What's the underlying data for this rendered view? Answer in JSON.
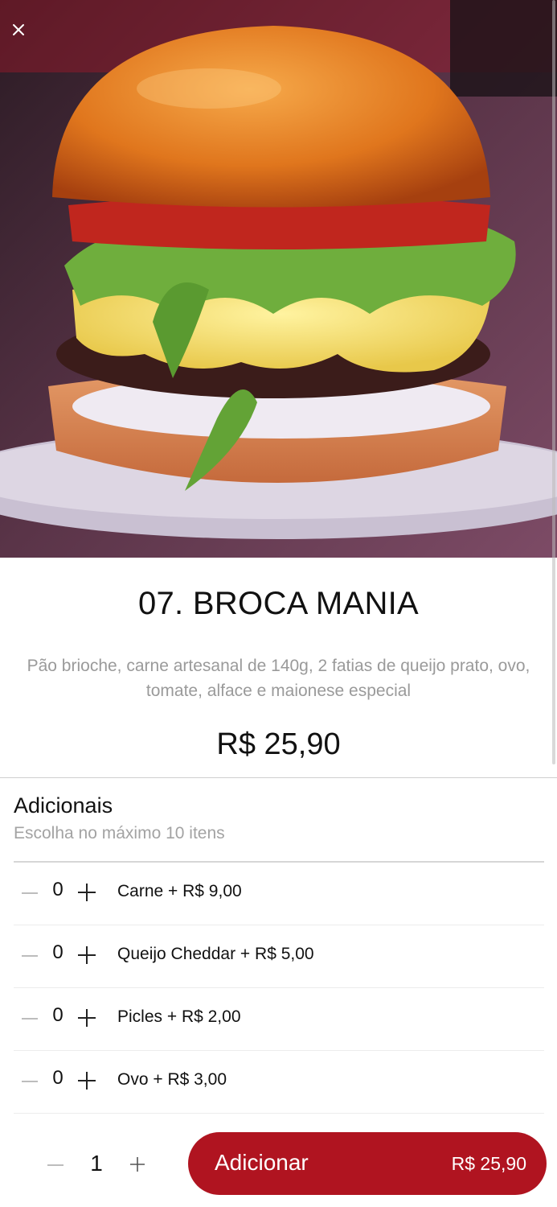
{
  "header": {
    "close_icon": "close-icon",
    "image_alt": "07. BROCA MANIA"
  },
  "product": {
    "title": "07. BROCA MANIA",
    "description": "Pão brioche, carne artesanal de 140g, 2 fatias de queijo prato, ovo, tomate, alface e maionese especial",
    "price": "R$ 25,90"
  },
  "addons": {
    "title": "Adicionais",
    "subtitle": "Escolha no máximo 10 itens",
    "items": [
      {
        "label": "Carne + R$ 9,00",
        "qty": "0"
      },
      {
        "label": "Queijo Cheddar + R$ 5,00",
        "qty": "0"
      },
      {
        "label": "Picles + R$ 2,00",
        "qty": "0"
      },
      {
        "label": "Ovo + R$ 3,00",
        "qty": "0"
      }
    ]
  },
  "footer": {
    "qty": "1",
    "add_label": "Adicionar",
    "add_price": "R$ 25,90"
  },
  "colors": {
    "accent": "#b01420",
    "text": "#111111",
    "muted": "#9a9a9a"
  }
}
